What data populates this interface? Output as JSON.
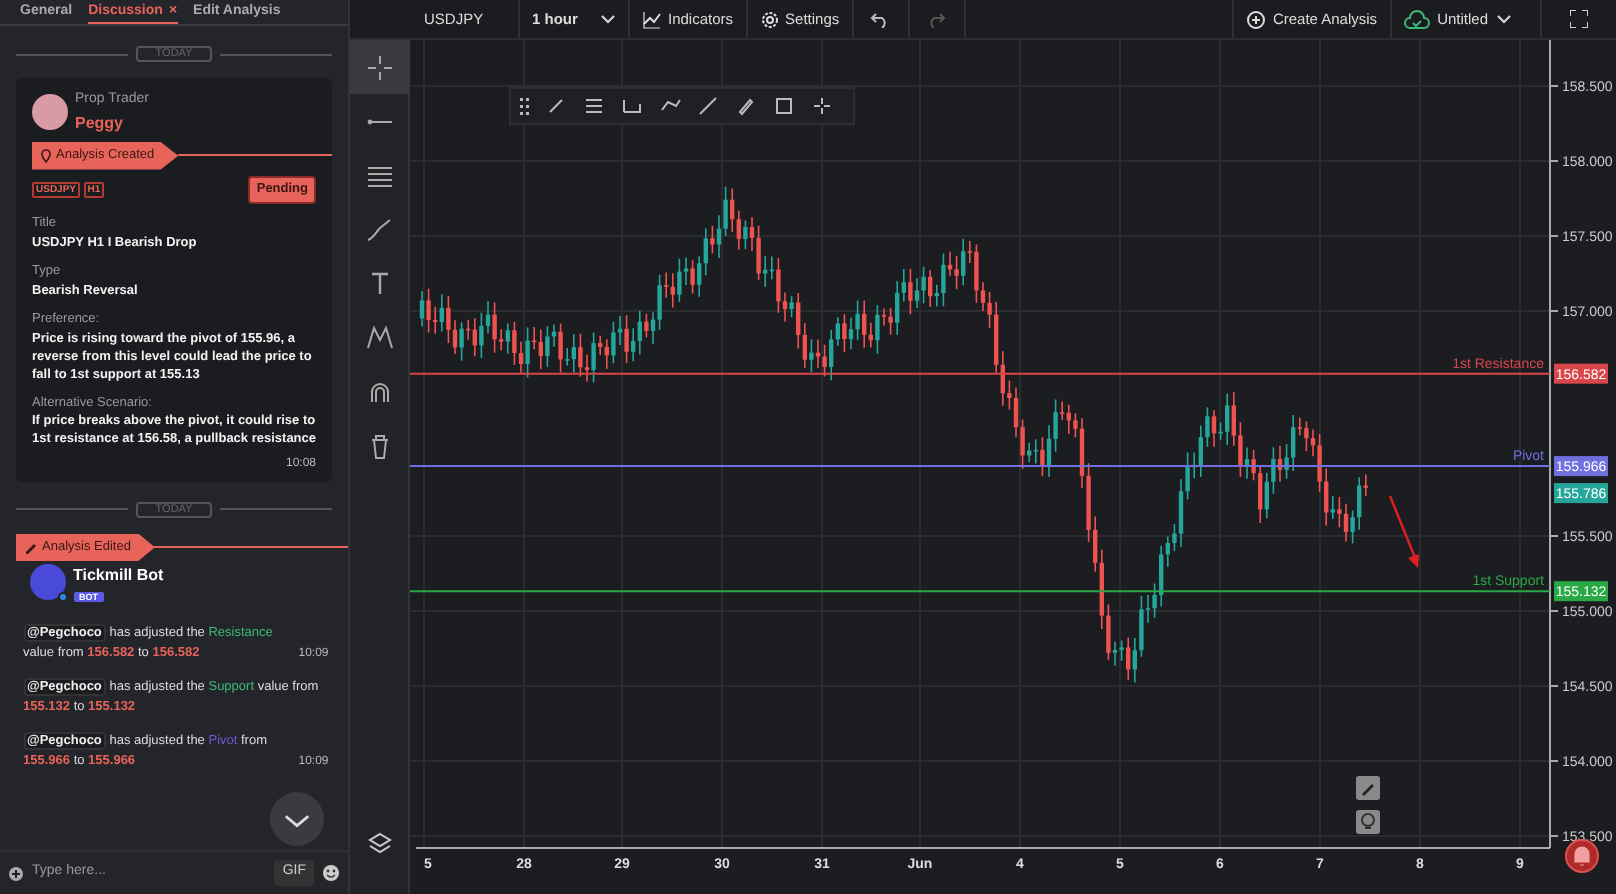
{
  "tabs": [
    {
      "label": "General",
      "selected": false
    },
    {
      "label": "Discussion",
      "selected": true,
      "close": "×"
    },
    {
      "label": "Edit Analysis",
      "selected": false
    }
  ],
  "chat": {
    "messages": [
      {
        "kind": "analysis",
        "date": "TODAY",
        "role": "Prop Trader",
        "author": "Peggy",
        "event": "Analysis Created",
        "tags": [
          "USDJPY",
          "H1"
        ],
        "status": "Pending",
        "fields": [
          {
            "label": "Title",
            "value": "USDJPY H1 I Bearish Drop"
          },
          {
            "label": "Type",
            "value": "Bearish Reversal"
          },
          {
            "label": "Preference:",
            "value": "Price is rising toward **the pivot of 155.96**, a reverse from this level could lead the price to fall to **1st support at 155.13**"
          },
          {
            "label": "Alternative Scenario:",
            "value": "If price breaks above the pivot, it could rise  to **1st resistance at 156.58**, a pullback resistance"
          }
        ],
        "time": "10:08"
      },
      {
        "kind": "edit",
        "date": "TODAY",
        "event": "Analysis Edited",
        "author": "Tickmill Bot",
        "badge": "BOT",
        "lines": [
          {
            "mention": "@Pegchoco",
            "color": "#3cb878",
            "parts": [
              {
                "kind": "plain",
                "t": "has adjusted the"
              },
              {
                "kind": "level",
                "t": "Resistance"
              },
              {
                "kind": "plain",
                "t": "value from"
              },
              {
                "kind": "value",
                "t": "156.582"
              },
              {
                "kind": "plain",
                "t": "to"
              },
              {
                "kind": "value",
                "t": "156.582"
              }
            ],
            "time": "10:09"
          },
          {
            "mention": "@Pegchoco",
            "color": "#3cb878",
            "parts": [
              {
                "kind": "plain",
                "t": "has adjusted the"
              },
              {
                "kind": "level",
                "t": "Support"
              },
              {
                "kind": "plain",
                "t": "value from"
              },
              {
                "kind": "value",
                "t": "155.132"
              },
              {
                "kind": "plain",
                "t": "to"
              },
              {
                "kind": "value",
                "t": "155.132"
              }
            ]
          },
          {
            "mention": "@Pegchoco",
            "color": "#6a5acd",
            "parts": [
              {
                "kind": "plain",
                "t": "has adjusted the"
              },
              {
                "kind": "level",
                "t": "Pivot"
              },
              {
                "kind": "plain",
                "t": "from"
              },
              {
                "kind": "value",
                "t": "155.966"
              },
              {
                "kind": "plain",
                "t": "to"
              },
              {
                "kind": "value",
                "t": "155.966"
              }
            ],
            "time": "10:09"
          }
        ]
      }
    ],
    "input": {
      "placeholder": "Type here...",
      "gif": "GIF"
    }
  },
  "topbar": {
    "symbol": "USDJPY",
    "timeframe": "1 hour",
    "indicators": "Indicators",
    "settings": "Settings",
    "undo": {
      "disabled": false
    },
    "redo": {
      "disabled": true
    },
    "create": "Create Analysis",
    "layout": "Untitled"
  },
  "drawing_tools": [
    {
      "kind": "crosshair",
      "selected": true
    },
    {
      "kind": "hline",
      "selected": false
    },
    {
      "kind": "lines",
      "selected": false
    },
    {
      "kind": "brush",
      "selected": false
    },
    {
      "kind": "text",
      "selected": false
    },
    {
      "kind": "pattern",
      "selected": false
    },
    {
      "kind": "magnet",
      "selected": false
    },
    {
      "kind": "trash",
      "selected": false
    }
  ],
  "chart": {
    "price_ticks": [
      "158.500",
      "158.000",
      "157.500",
      "157.000",
      "155.500",
      "155.000",
      "154.500",
      "154.000",
      "153.500"
    ],
    "time_ticks": [
      "5",
      "28",
      "29",
      "30",
      "31",
      "Jun",
      "4",
      "5",
      "6",
      "7",
      "8",
      "9"
    ],
    "levels": [
      {
        "label": "1st Resistance",
        "tag": "156.582",
        "color": "#d9464b"
      },
      {
        "label": "Pivot",
        "tag": "155.966",
        "color": "#6f6fe0"
      },
      {
        "label": "1st Support",
        "tag": "155.132",
        "color": "#2aa845"
      }
    ],
    "last_price": "155.786"
  }
}
